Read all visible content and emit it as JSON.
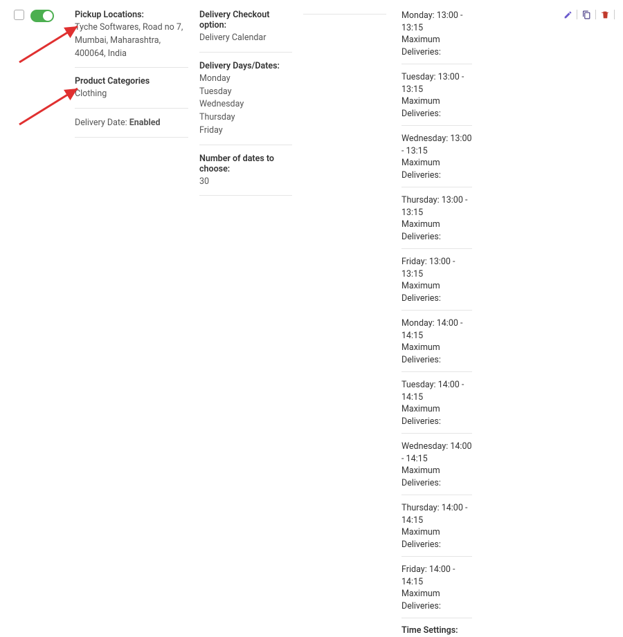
{
  "col1": {
    "pickup_label": "Pickup Locations:",
    "pickup_value": "Tyche Softwares, Road no 7, Mumbai, Maharashtra, 400064, India",
    "product_categories_label": "Product Categories",
    "product_categories_value": "Clothing",
    "delivery_date_label": "Delivery Date: ",
    "delivery_date_value": "Enabled"
  },
  "col2": {
    "checkout_label": "Delivery Checkout option:",
    "checkout_value": "Delivery Calendar",
    "days_label": "Delivery Days/Dates:",
    "days": [
      "Monday",
      "Tuesday",
      "Wednesday",
      "Thursday",
      "Friday"
    ],
    "num_dates_label": "Number of dates to choose:",
    "num_dates_value": "30"
  },
  "col4": {
    "slots": [
      {
        "line1": "Monday: 13:00 - 13:15",
        "line2": "Maximum Deliveries:"
      },
      {
        "line1": "Tuesday: 13:00 - 13:15",
        "line2": "Maximum Deliveries:"
      },
      {
        "line1": "Wednesday: 13:00 - 13:15",
        "line2": "Maximum Deliveries:"
      },
      {
        "line1": "Thursday: 13:00 - 13:15",
        "line2": "Maximum Deliveries:"
      },
      {
        "line1": "Friday: 13:00 - 13:15",
        "line2": "Maximum Deliveries:"
      },
      {
        "line1": "Monday: 14:00 - 14:15",
        "line2": "Maximum Deliveries:"
      },
      {
        "line1": "Tuesday: 14:00 - 14:15",
        "line2": "Maximum Deliveries:"
      },
      {
        "line1": "Wednesday: 14:00 - 14:15",
        "line2": "Maximum Deliveries:"
      },
      {
        "line1": "Thursday: 14:00 - 14:15",
        "line2": "Maximum Deliveries:"
      },
      {
        "line1": "Friday: 14:00 - 14:15",
        "line2": "Maximum Deliveries:"
      }
    ],
    "time_settings_label": "Time Settings:"
  },
  "colors": {
    "edit": "#6a5acd",
    "copy": "#3b2e7e",
    "delete": "#c0392b"
  }
}
